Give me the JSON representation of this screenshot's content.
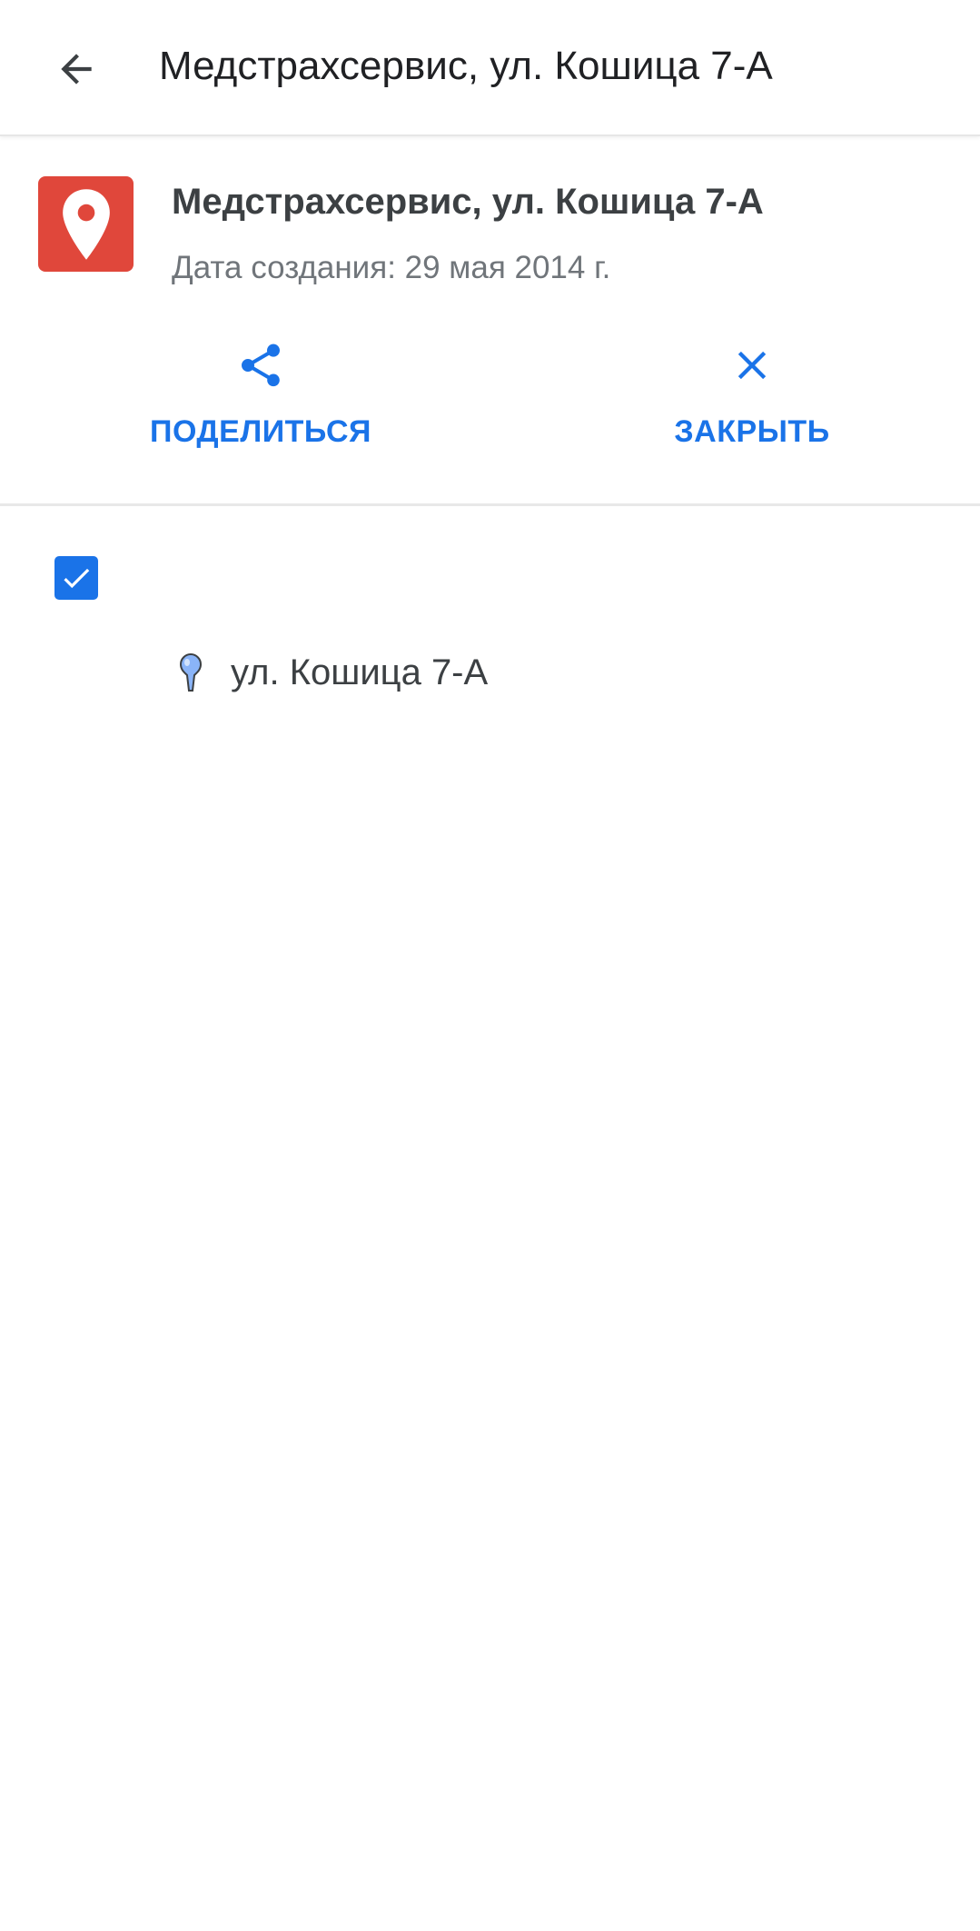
{
  "app_bar": {
    "title": "Медстрахсервис, ул. Кошица 7-А",
    "back_icon": "arrow-back-icon"
  },
  "map": {
    "logo_icon": "map-pin-icon",
    "logo_color": "#e0473b",
    "name": "Медстрахсервис, ул. Кошица 7-А",
    "created": "Дата создания: 29 мая 2014 г."
  },
  "actions": {
    "share_label": "ПОДЕЛИТЬСЯ",
    "share_icon": "share-icon",
    "close_label": "ЗАКРЫТЬ",
    "close_icon": "close-icon",
    "accent_color": "#1a73e8"
  },
  "layer": {
    "checked": true,
    "places": [
      {
        "label": "ул. Кошица 7-А",
        "icon": "blue-pushpin-icon"
      }
    ]
  }
}
